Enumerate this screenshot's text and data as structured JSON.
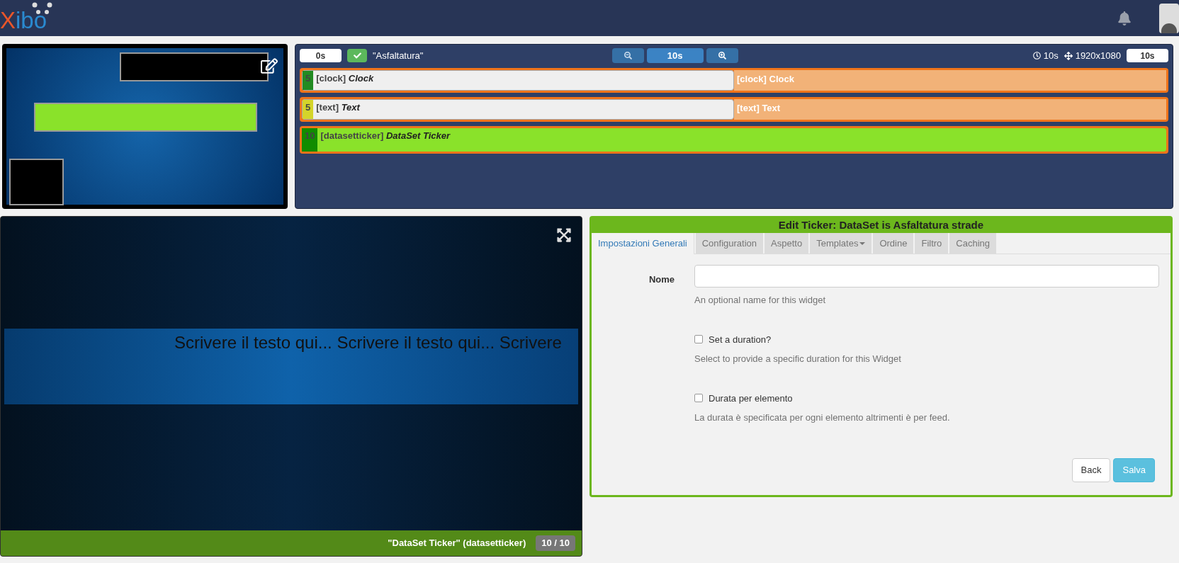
{
  "header": {
    "logo_letter": "X",
    "logo_rest": "ibo"
  },
  "layout_preview": {
    "regions": [
      {
        "kind": "black"
      },
      {
        "kind": "green"
      },
      {
        "kind": "black"
      }
    ]
  },
  "timeline": {
    "start": "0s",
    "title": "\"Asfaltatura\"",
    "zoom": "10s",
    "duration": "10s",
    "resolution": "1920x1080",
    "end": "10s",
    "rows": [
      {
        "kind": "split",
        "count": "5",
        "color": "#228b22",
        "type": "[clock]",
        "name": "Clock",
        "tail": "[clock] Clock"
      },
      {
        "kind": "split",
        "count": "5",
        "color": "#d4d42a",
        "type": "[text]",
        "name": "Text",
        "tail": "[text] Text"
      },
      {
        "kind": "full",
        "count": "10",
        "color": "#118c00",
        "type": "[datasetticker]",
        "name": "DataSet Ticker"
      }
    ]
  },
  "preview": {
    "ticker_text": "Scrivere il testo qui... Scrivere il testo qui... Scrivere",
    "caption": "\"DataSet Ticker\" (datasetticker)",
    "counter": "10 / 10"
  },
  "edit": {
    "title": "Edit Ticker: DataSet is Asfaltatura strade",
    "tabs": [
      {
        "label": "Impostazioni Generali",
        "selected": true,
        "dropdown": false
      },
      {
        "label": "Configuration",
        "selected": false,
        "dropdown": false
      },
      {
        "label": "Aspetto",
        "selected": false,
        "dropdown": false
      },
      {
        "label": "Templates",
        "selected": false,
        "dropdown": true
      },
      {
        "label": "Ordine",
        "selected": false,
        "dropdown": false
      },
      {
        "label": "Filtro",
        "selected": false,
        "dropdown": false
      },
      {
        "label": "Caching",
        "selected": false,
        "dropdown": false
      }
    ],
    "fields": [
      {
        "kind": "text",
        "label": "Nome",
        "help": "An optional name for this widget"
      },
      {
        "kind": "checkbox",
        "label": "Set a duration?",
        "checked": false,
        "help": "Select to provide a specific duration for this Widget"
      },
      {
        "kind": "checkbox",
        "label": "Durata per elemento",
        "checked": false,
        "help": "La durata è specificata per ogni elemento altrimenti è per feed."
      }
    ],
    "buttons": [
      {
        "label": "Back",
        "kind": "default"
      },
      {
        "label": "Salva",
        "kind": "primary"
      }
    ]
  }
}
